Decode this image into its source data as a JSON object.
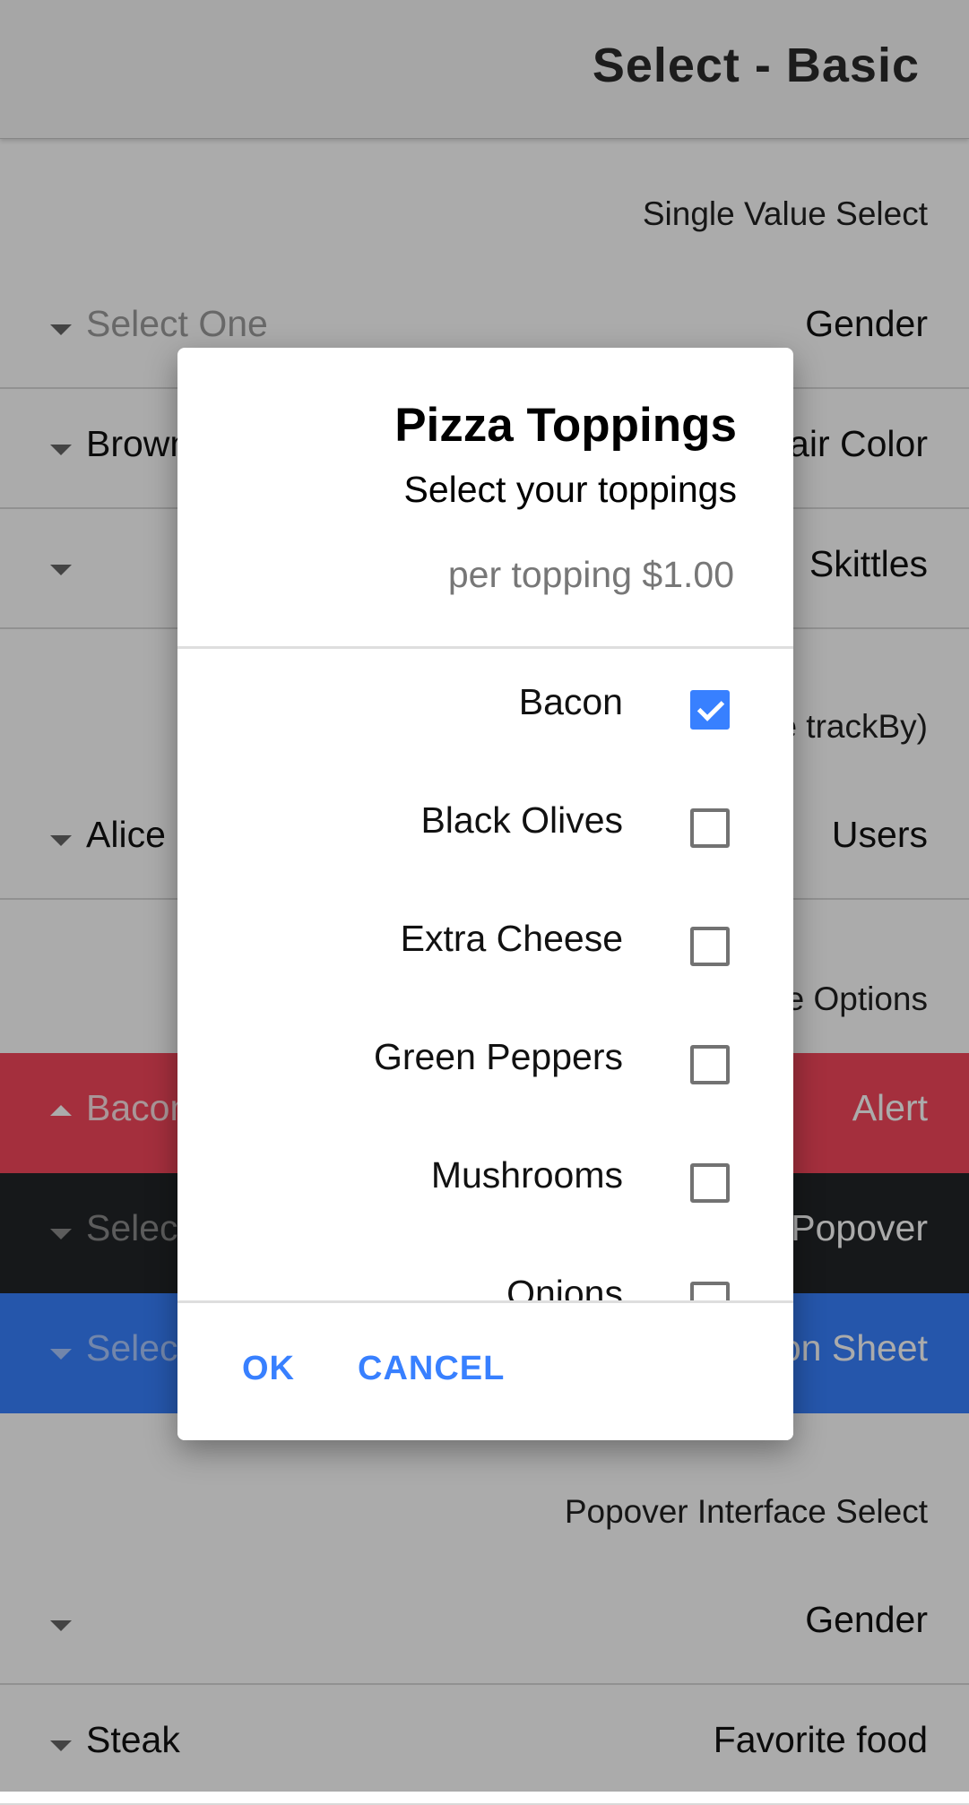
{
  "toolbar": {
    "title": "Select - Basic"
  },
  "sections": {
    "single": "Single Value Select",
    "trackby": "Objects as Values (Use trackBy)",
    "interface": "Interface Options",
    "popover_header": "Popover Interface Select"
  },
  "rows": [
    {
      "label": "Gender",
      "value": "Select One",
      "placeholder": true
    },
    {
      "label": "Hair Color",
      "value": "Brown",
      "placeholder": false
    },
    {
      "label": "Skittles",
      "value": "",
      "placeholder": false
    },
    {
      "label": "Users",
      "value": "Alice Smith",
      "placeholder": false
    },
    {
      "label": "Alert",
      "value": "Bacon",
      "placeholder": true
    },
    {
      "label": "Popover",
      "value": "Select One",
      "placeholder": true
    },
    {
      "label": "Action Sheet",
      "value": "Select One",
      "placeholder": true
    },
    {
      "label": "Gender",
      "value": "",
      "placeholder": false
    },
    {
      "label": "Favorite food",
      "value": "Steak",
      "placeholder": false
    }
  ],
  "dialog": {
    "title": "Pizza Toppings",
    "subtitle": "Select your toppings",
    "message": "per topping $1.00",
    "options": [
      {
        "label": "Bacon",
        "checked": true
      },
      {
        "label": "Black Olives",
        "checked": false
      },
      {
        "label": "Extra Cheese",
        "checked": false
      },
      {
        "label": "Green Peppers",
        "checked": false
      },
      {
        "label": "Mushrooms",
        "checked": false
      },
      {
        "label": "Onions",
        "checked": false
      }
    ],
    "ok_label": "OK",
    "cancel_label": "CANCEL"
  },
  "colors": {
    "primary": "#3880ff",
    "danger": "#f5475c",
    "dark": "#222428"
  }
}
